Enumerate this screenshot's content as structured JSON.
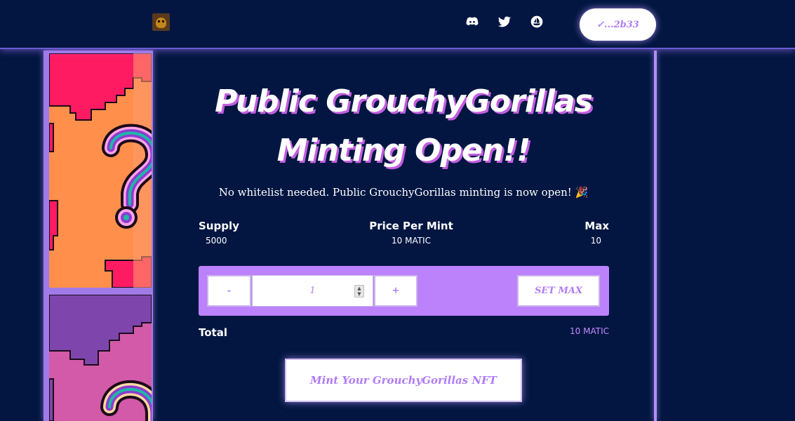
{
  "header": {
    "wallet_label": "✓...2b33",
    "social": [
      "discord-icon",
      "twitter-icon",
      "opensea-icon"
    ]
  },
  "main": {
    "title_line1": "Public GrouchyGorillas",
    "title_line2": "Minting Open!!",
    "subtitle": "No whitelist needed. Public GrouchyGorillas minting is now open! 🎉",
    "stats": {
      "supply_label": "Supply",
      "supply_value": "5000",
      "price_label": "Price Per Mint",
      "price_value": "10 MATIC",
      "max_label": "Max",
      "max_value": "10"
    },
    "controls": {
      "minus_label": "-",
      "quantity": "1",
      "plus_label": "+",
      "set_max_label": "SET MAX"
    },
    "total_label": "Total",
    "total_value": "10 MATIC",
    "mint_button": "Mint Your GrouchyGorillas NFT"
  },
  "colors": {
    "background": "#021641",
    "accent": "#bc82fc",
    "button_text": "#b07cf5"
  }
}
